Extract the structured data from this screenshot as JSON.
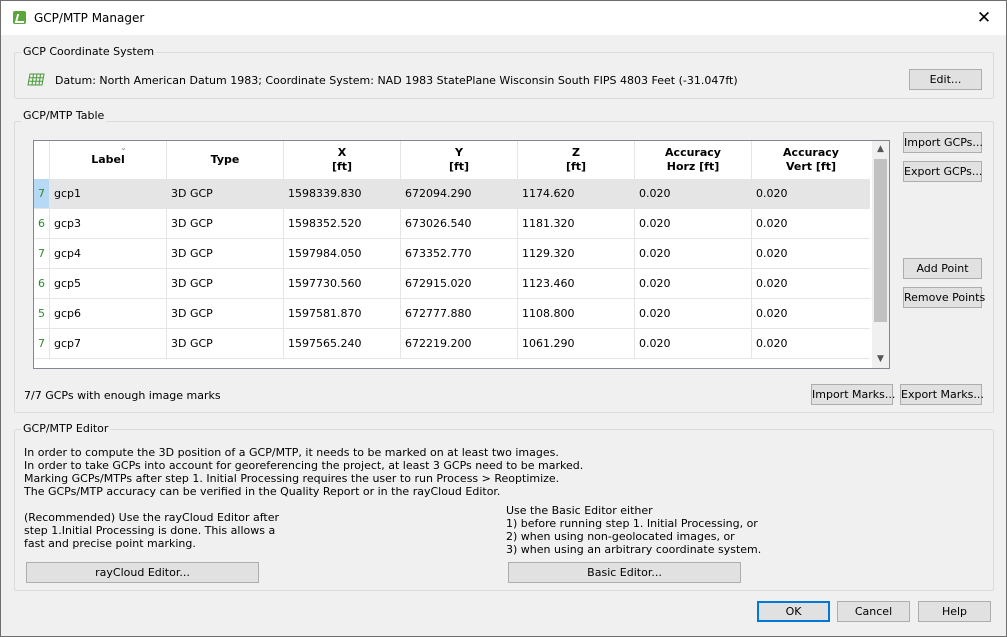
{
  "window": {
    "title": "GCP/MTP Manager",
    "close_glyph": "✕"
  },
  "coord_system": {
    "group_title": "GCP Coordinate System",
    "description": "Datum: North American Datum 1983; Coordinate System: NAD 1983 StatePlane Wisconsin South FIPS 4803 Feet (-31.047ft)",
    "edit_label": "Edit...",
    "icon": "grid-icon"
  },
  "table": {
    "group_title": "GCP/MTP Table",
    "headers": {
      "label": "Label",
      "type": "Type",
      "x": "X",
      "x_unit": "[ft]",
      "y": "Y",
      "y_unit": "[ft]",
      "z": "Z",
      "z_unit": "[ft]",
      "acc_horz": "Accuracy",
      "acc_horz_unit": "Horz [ft]",
      "acc_vert": "Accuracy",
      "acc_vert_unit": "Vert [ft]"
    },
    "rows": [
      {
        "num": "7",
        "label": "gcp1",
        "type": "3D GCP",
        "x": "1598339.830",
        "y": "672094.290",
        "z": "1174.620",
        "acc_h": "0.020",
        "acc_v": "0.020"
      },
      {
        "num": "6",
        "label": "gcp3",
        "type": "3D GCP",
        "x": "1598352.520",
        "y": "673026.540",
        "z": "1181.320",
        "acc_h": "0.020",
        "acc_v": "0.020"
      },
      {
        "num": "7",
        "label": "gcp4",
        "type": "3D GCP",
        "x": "1597984.050",
        "y": "673352.770",
        "z": "1129.320",
        "acc_h": "0.020",
        "acc_v": "0.020"
      },
      {
        "num": "6",
        "label": "gcp5",
        "type": "3D GCP",
        "x": "1597730.560",
        "y": "672915.020",
        "z": "1123.460",
        "acc_h": "0.020",
        "acc_v": "0.020"
      },
      {
        "num": "5",
        "label": "gcp6",
        "type": "3D GCP",
        "x": "1597581.870",
        "y": "672777.880",
        "z": "1108.800",
        "acc_h": "0.020",
        "acc_v": "0.020"
      },
      {
        "num": "7",
        "label": "gcp7",
        "type": "3D GCP",
        "x": "1597565.240",
        "y": "672219.200",
        "z": "1061.290",
        "acc_h": "0.020",
        "acc_v": "0.020"
      }
    ],
    "import_gcps": "Import GCPs...",
    "export_gcps": "Export GCPs...",
    "add_point": "Add Point",
    "remove_points": "Remove Points",
    "status": "7/7 GCPs with enough image marks",
    "import_marks": "Import Marks...",
    "export_marks": "Export Marks..."
  },
  "editor": {
    "group_title": "GCP/MTP Editor",
    "info_lines": [
      "In order to compute the 3D position of a GCP/MTP, it needs to be marked on at least two images.",
      "In order to take GCPs into account for georeferencing the project, at least 3 GCPs need to be marked.",
      "Marking GCPs/MTPs after step 1. Initial Processing requires the user to run Process > Reoptimize.",
      "The GCPs/MTP accuracy can be verified in the Quality Report or in the rayCloud Editor."
    ],
    "raycloud_lines": [
      "(Recommended) Use the rayCloud Editor after",
      "step 1.Initial Processing is done. This allows a",
      "fast and precise point marking."
    ],
    "basic_lines": [
      "Use the Basic Editor either",
      "1) before running step 1. Initial Processing, or",
      "2) when using non-geolocated images, or",
      "3) when using an arbitrary coordinate system."
    ],
    "raycloud_button": "rayCloud Editor...",
    "basic_button": "Basic Editor..."
  },
  "footer": {
    "ok": "OK",
    "cancel": "Cancel",
    "help": "Help"
  },
  "colors": {
    "accent": "#0078d7",
    "row_num_green": "#2e8b2e",
    "selected_row": "#e5e5e5"
  }
}
